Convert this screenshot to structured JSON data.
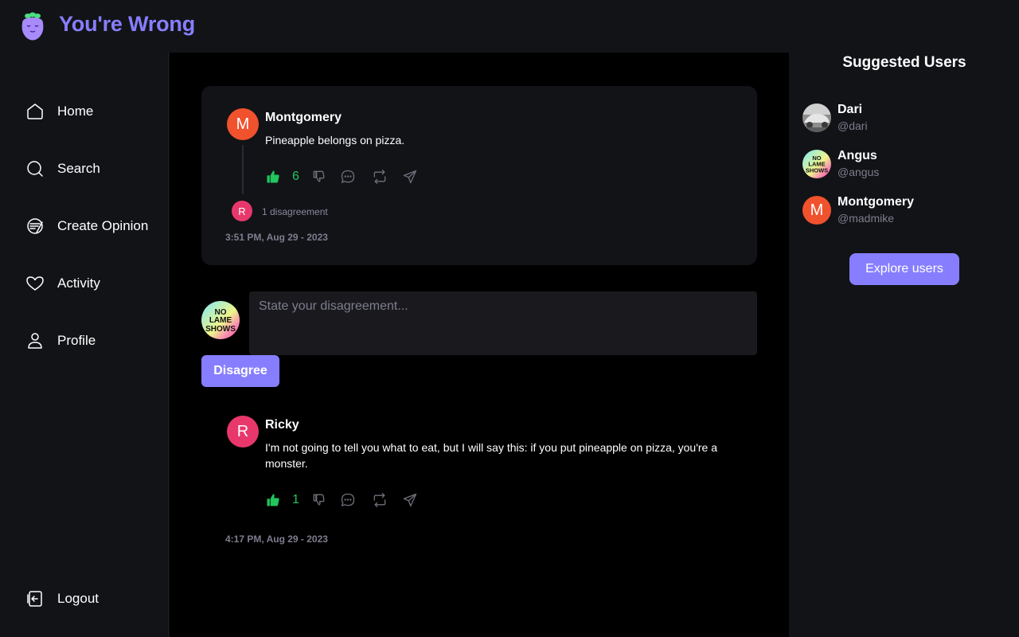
{
  "app": {
    "title": "You're Wrong"
  },
  "nav": {
    "items": [
      {
        "label": "Home",
        "icon": "home-icon"
      },
      {
        "label": "Search",
        "icon": "search-icon"
      },
      {
        "label": "Create Opinion",
        "icon": "create-opinion-icon"
      },
      {
        "label": "Activity",
        "icon": "heart-icon"
      },
      {
        "label": "Profile",
        "icon": "user-icon"
      }
    ],
    "logout": {
      "label": "Logout",
      "icon": "logout-icon"
    }
  },
  "opinion": {
    "avatar_initial": "M",
    "author": "Montgomery",
    "text": "Pineapple belongs on pizza.",
    "likes": "6",
    "reply_avatar_initial": "R",
    "disagreements": "1 disagreement",
    "timestamp": "3:51 PM, Aug 29 - 2023"
  },
  "composer": {
    "placeholder": "State your disagreement...",
    "button_label": "Disagree",
    "avatar_text": [
      "NO",
      "LAME",
      "SHOWS"
    ]
  },
  "reply": {
    "avatar_initial": "R",
    "author": "Ricky",
    "text": "I'm not going to tell you what to eat, but I will say this: if you put pineapple on pizza, you're a monster.",
    "likes": "1",
    "timestamp": "4:17 PM, Aug 29 - 2023"
  },
  "suggested": {
    "title": "Suggested Users",
    "users": [
      {
        "name": "Dari",
        "handle": "@dari"
      },
      {
        "name": "Angus",
        "handle": "@angus"
      },
      {
        "name": "Montgomery",
        "handle": "@madmike",
        "initial": "M"
      }
    ],
    "explore_label": "Explore users"
  },
  "colors": {
    "accent": "#877eff",
    "like_green": "#22c55e",
    "avatar_orange": "#f0522e",
    "avatar_pink": "#e8386b"
  }
}
